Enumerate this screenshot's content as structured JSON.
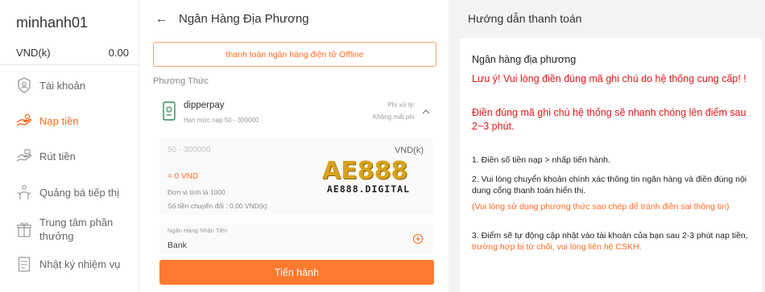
{
  "sidebar": {
    "username": "minhanh01",
    "currency": "VND(k)",
    "balance": "0.00",
    "items": [
      {
        "label": "Tài khoản",
        "icon": "user-shield-icon"
      },
      {
        "label": "Nạp tiền",
        "icon": "deposit-icon"
      },
      {
        "label": "Rút tiền",
        "icon": "withdraw-icon"
      },
      {
        "label": "Quảng bá tiếp thị",
        "icon": "promotion-icon"
      },
      {
        "label_line1": "Trung tâm phần",
        "label_line2": "thưởng",
        "icon": "reward-icon"
      },
      {
        "label": "Nhật ký nhiệm vụ",
        "icon": "task-log-icon"
      }
    ]
  },
  "deposit": {
    "title": "Ngân Hàng Địa Phương",
    "tab": "thanh toán ngân hàng điện tử Offline",
    "method_label": "Phương Thức",
    "method": {
      "name": "dipperpay",
      "limit": "Hạn mức nạp 50 - 300000",
      "fee_label": "Phí xử lý:",
      "fee_value": "Không mất phí"
    },
    "amount": {
      "placeholder": "50 - 300000",
      "currency": "VND(k)",
      "equivalent": "= 0 VND",
      "unit": "Đơn vị tính là 1000",
      "converted": "Số tiền chuyển đổi : 0.00 VND(k)"
    },
    "bank": {
      "label": "Ngân Hàng Nhận Tiền",
      "value": "Bank"
    },
    "submit": "Tiến hành"
  },
  "watermark": {
    "logo": "AE888",
    "domain": "AE888.DIGITAL"
  },
  "guide": {
    "title": "Hướng dẫn thanh toán",
    "heading": "Ngân hàng địa phương",
    "warning1": "Lưu ý! Vui lòng điền đúng mã ghi chú do hệ thống cung cấp! !",
    "warning2": "Điền đúng mã ghi chú hệ thống sẽ nhanh chóng lên điểm sau 2~3 phút.",
    "step1": "1. Điền số tiền nạp > nhấp tiến hành.",
    "step2": "2. Vui lòng chuyển khoản chính xác thông tin ngân hàng và điền đúng nội dung cổng thanh toán hiển thị.",
    "note": "(Vui lòng sử dụng phương thức sao chép để tránh điền sai thông tin)",
    "step3_main": "3. Điểm sẽ tự động cập nhật vào tài khoản của bạn sau 2-3 phút nạp tiền,",
    "step3_orange": " trường hợp bị từ chối, vui lòng liên hệ CSKH."
  },
  "colors": {
    "accent": "#ff6a22",
    "button": "#ff7a2f",
    "warning": "#e01818"
  }
}
